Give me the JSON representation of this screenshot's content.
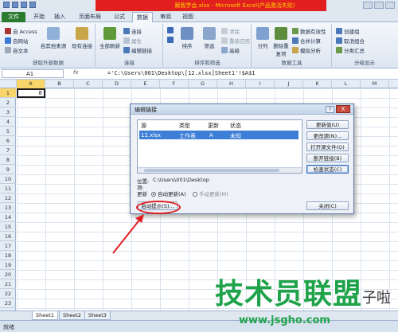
{
  "window": {
    "title": "跟我学会.xlsx - Microsoft Excel(产品激活失败)"
  },
  "ribbon": {
    "tabs": [
      "文件",
      "开始",
      "插入",
      "页面布局",
      "公式",
      "数据",
      "审阅",
      "视图"
    ],
    "active_tab": "数据",
    "groups": {
      "external": {
        "label": "获取外部数据",
        "items": [
          "自 Access",
          "自网站",
          "自文本",
          "自其他来源",
          "现有连接"
        ]
      },
      "connections": {
        "label": "连接",
        "items": [
          "全部刷新",
          "连接",
          "属性",
          "编辑链接"
        ]
      },
      "sortfilter": {
        "label": "排序和筛选",
        "items": [
          "排序",
          "筛选",
          "清除",
          "重新应用",
          "高级"
        ]
      },
      "datatools": {
        "label": "数据工具",
        "items": [
          "分列",
          "删除重复项",
          "数据有效性",
          "合并计算",
          "模拟分析"
        ]
      },
      "outline": {
        "label": "分级显示",
        "items": [
          "创建组",
          "取消组合",
          "分类汇总"
        ]
      }
    }
  },
  "formula_bar": {
    "name_box": "A1",
    "fx": "fx",
    "formula": "='C:\\Users\\001\\Desktop\\[12.xlsx]Sheet1'!$A$1"
  },
  "grid": {
    "columns": [
      "A",
      "B",
      "C",
      "D",
      "E",
      "F",
      "G",
      "H",
      "I",
      "J",
      "K",
      "L",
      "M"
    ],
    "rows": [
      "1",
      "2",
      "3",
      "4",
      "5",
      "6",
      "7",
      "8",
      "9",
      "10",
      "11",
      "12",
      "13",
      "14",
      "15",
      "16",
      "17",
      "18",
      "19",
      "20",
      "21",
      "22",
      "23"
    ],
    "a1_value": "8"
  },
  "sheets": [
    "Sheet1",
    "Sheet2",
    "Sheet3"
  ],
  "status": "就绪",
  "dialog": {
    "title": "编辑链接",
    "help": "?",
    "close": "X",
    "headers": [
      "源",
      "类型",
      "更新",
      "状态"
    ],
    "rows": [
      {
        "source": "12.xlsx",
        "type": "工作表",
        "update": "A",
        "status": "未知"
      }
    ],
    "buttons": [
      "更新值(U)",
      "更改源(N)...",
      "打开源文件(O)",
      "断开链接(B)",
      "检查状态(C)"
    ],
    "location_label": "位置:",
    "location_value": "C:\\Users\\001\\Desktop",
    "item_label": "项:",
    "update_label": "更新",
    "auto_update": "自动更新(A)",
    "manual_update": "手动更新(M)",
    "startup_prompt": "启动提示(S)...",
    "close_button": "关闭(C)"
  },
  "watermark": {
    "main": "技术员联盟",
    "tail": "子啦",
    "url": "www.jsgho.com"
  },
  "colors": {
    "file_tab": "#2a7a2f",
    "selection": "#3d7ed6",
    "annotation": "#e02020",
    "watermark": "#1fa34a"
  }
}
